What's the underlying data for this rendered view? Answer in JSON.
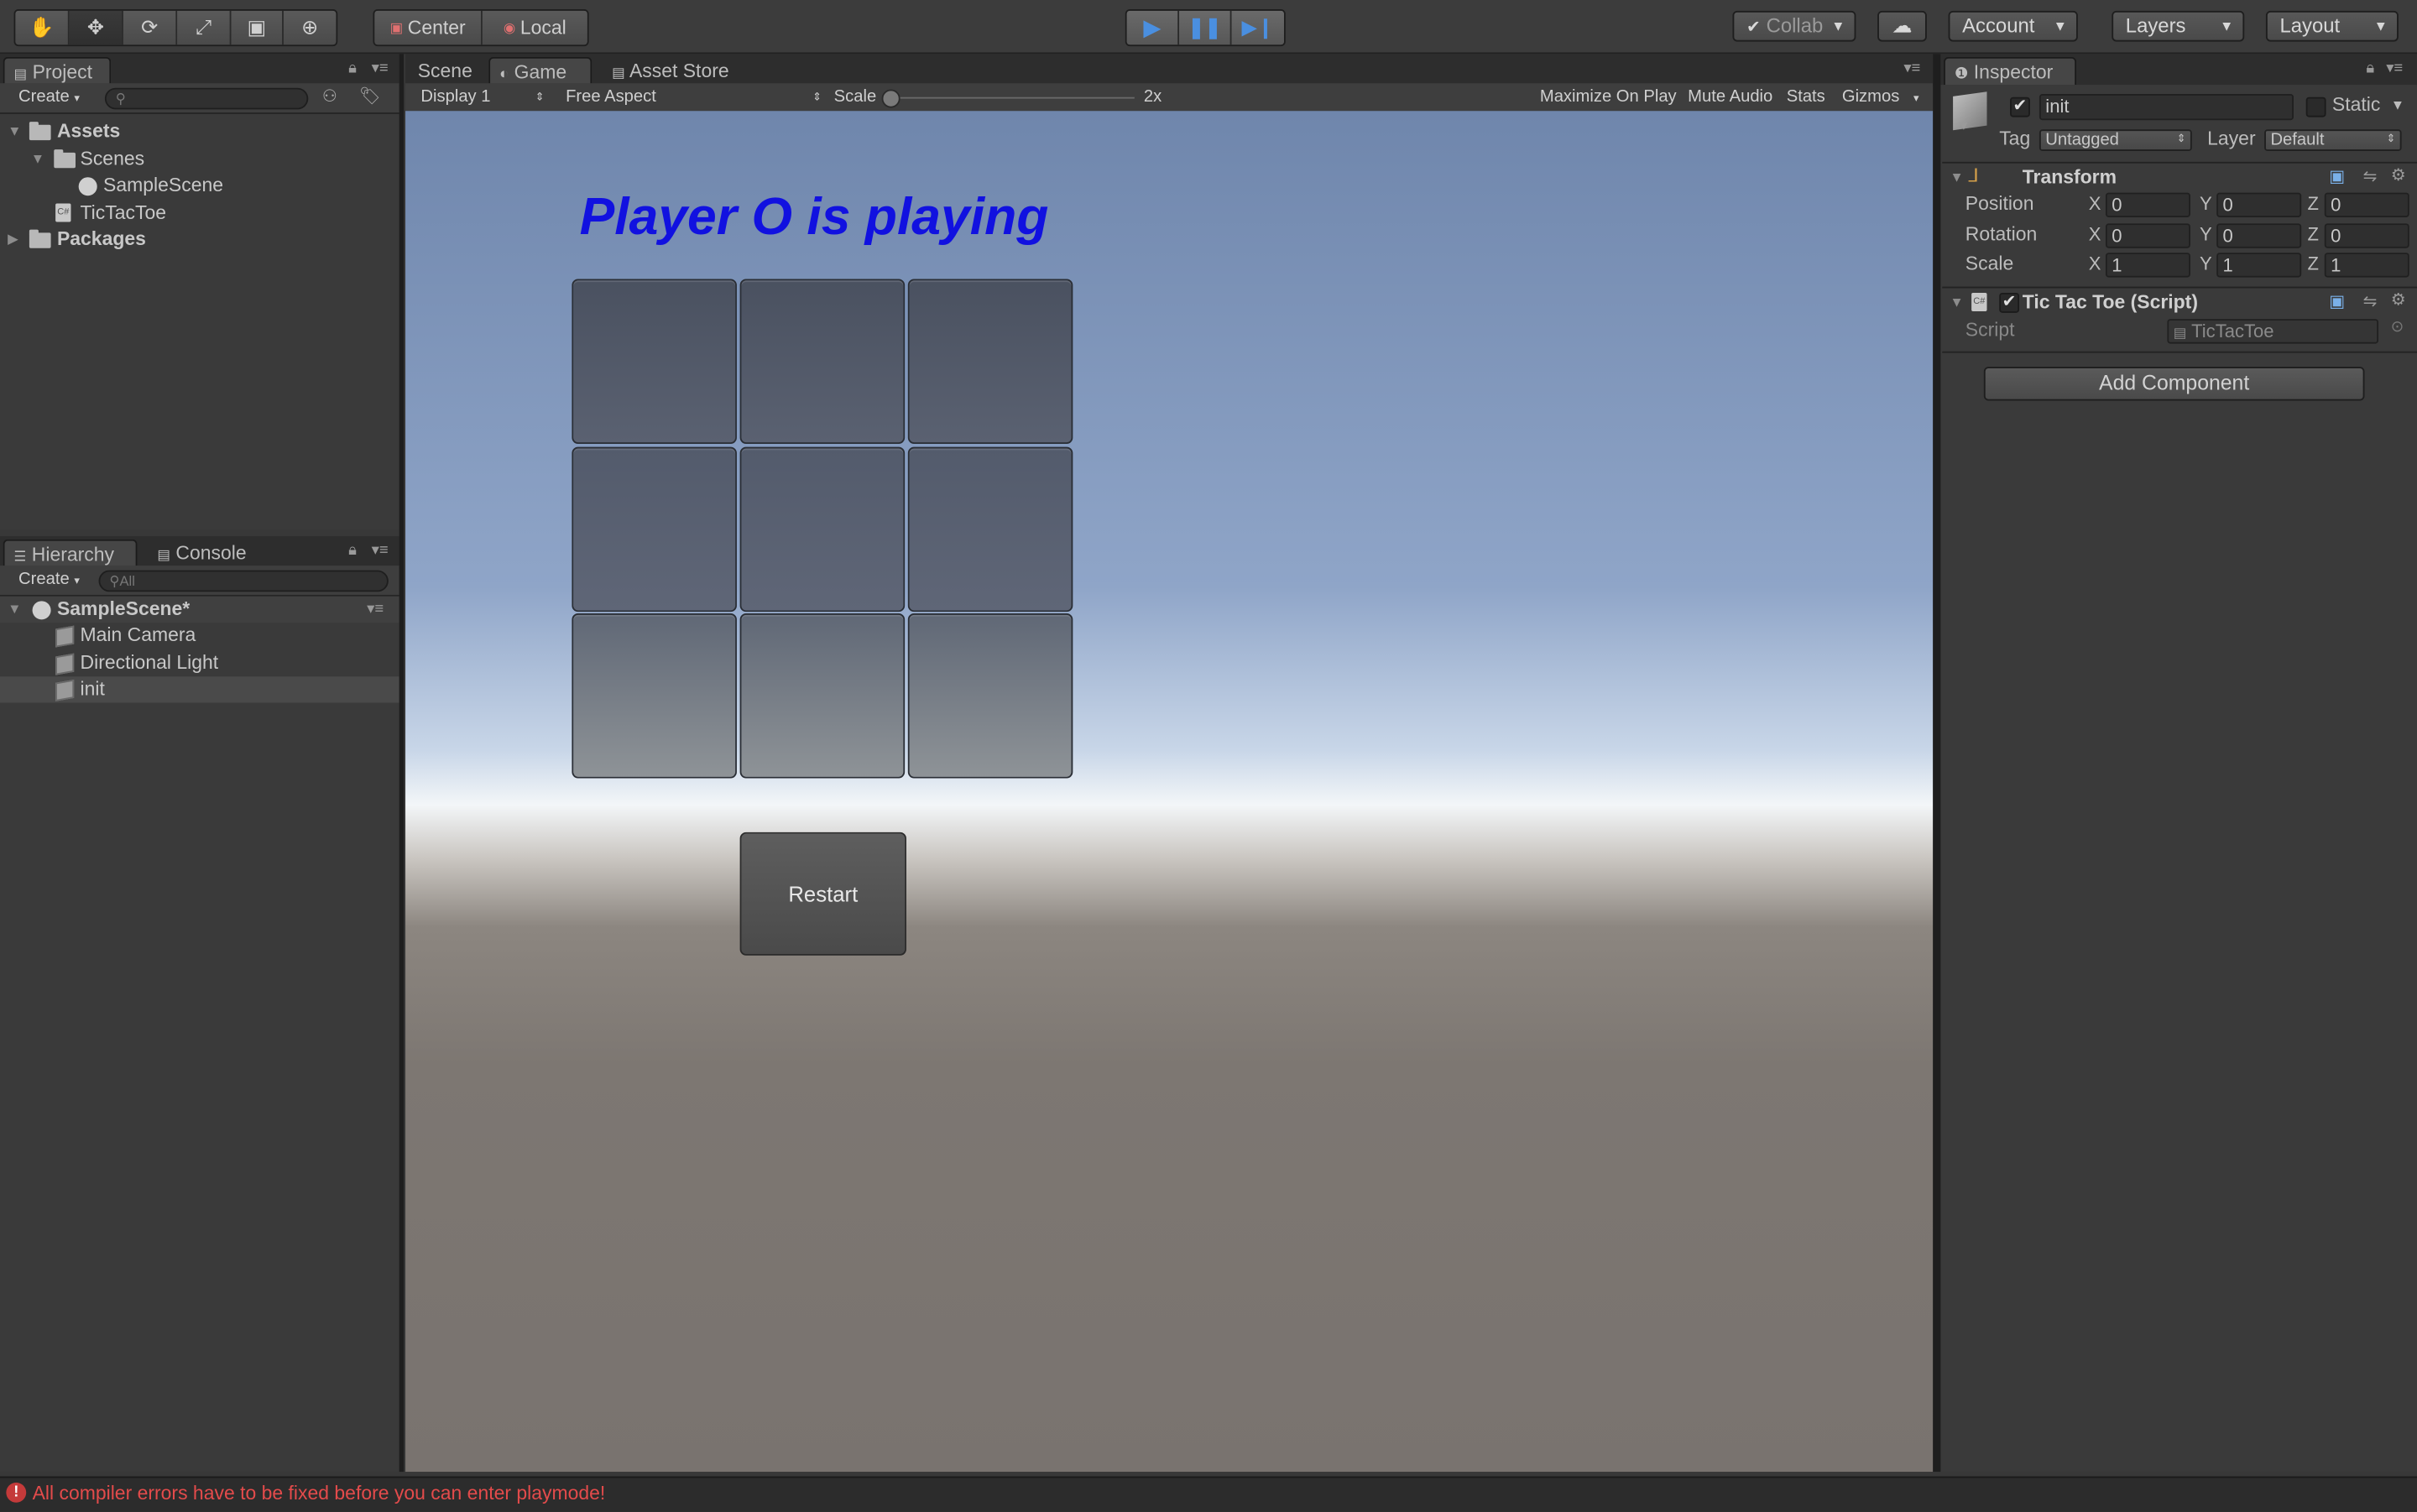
{
  "toolbar": {
    "tools": [
      "hand-icon",
      "move-icon",
      "rotate-icon",
      "scale-icon",
      "rect-icon",
      "transform-icon"
    ],
    "pivot_label": "Center",
    "space_label": "Local",
    "collab_label": "Collab",
    "account_label": "Account",
    "layers_label": "Layers",
    "layout_label": "Layout"
  },
  "project": {
    "tab_label": "Project",
    "create_label": "Create",
    "tree": [
      {
        "label": "Assets",
        "depth": 0
      },
      {
        "label": "Scenes",
        "depth": 1
      },
      {
        "label": "SampleScene",
        "depth": 2
      },
      {
        "label": "TicTacToe",
        "depth": 1
      },
      {
        "label": "Packages",
        "depth": 0
      }
    ]
  },
  "hierarchy": {
    "tab_label": "Hierarchy",
    "console_tab_label": "Console",
    "create_label": "Create",
    "search_placeholder": "All",
    "scene_label": "SampleScene*",
    "items": [
      "Main Camera",
      "Directional Light",
      "init"
    ]
  },
  "center_tabs": {
    "scene": "Scene",
    "game": "Game",
    "asset_store": "Asset Store"
  },
  "game_toolbar": {
    "display": "Display 1",
    "aspect": "Free Aspect",
    "scale_label": "Scale",
    "scale_value": "2x",
    "maximize": "Maximize On Play",
    "mute": "Mute Audio",
    "stats": "Stats",
    "gizmos": "Gizmos"
  },
  "game": {
    "status": "Player O is playing",
    "restart_label": "Restart",
    "cells": [
      "",
      "",
      "",
      "",
      "",
      "",
      "",
      "",
      ""
    ]
  },
  "inspector": {
    "tab_label": "Inspector",
    "object_name": "init",
    "static_label": "Static",
    "tag_label": "Tag",
    "tag_value": "Untagged",
    "layer_label": "Layer",
    "layer_value": "Default",
    "transform": {
      "title": "Transform",
      "position_label": "Position",
      "rotation_label": "Rotation",
      "scale_label": "Scale",
      "position": {
        "x": "0",
        "y": "0",
        "z": "0"
      },
      "rotation": {
        "x": "0",
        "y": "0",
        "z": "0"
      },
      "scale": {
        "x": "1",
        "y": "1",
        "z": "1"
      }
    },
    "script_component": {
      "title": "Tic Tac Toe (Script)",
      "script_label": "Script",
      "script_value": "TicTacToe"
    },
    "add_component_label": "Add Component"
  },
  "axis_labels": {
    "x": "X",
    "y": "Y",
    "z": "Z"
  },
  "status_bar": {
    "message": "All compiler errors have to be fixed before you can enter playmode!",
    "color": "#e34b4b"
  },
  "colors": {
    "play_accent": "#4a8fe0",
    "status_text": "#1111e0"
  }
}
